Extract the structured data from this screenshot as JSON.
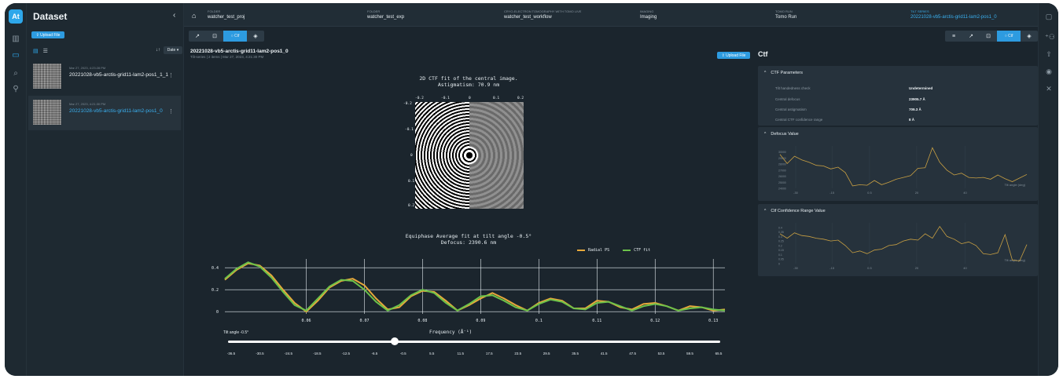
{
  "app": {
    "logo": "At"
  },
  "rail_icons": [
    "chart-icon",
    "folder-icon",
    "search-icon",
    "search-filter-icon"
  ],
  "dataset": {
    "title": "Dataset",
    "collapse": "‹",
    "upload_label": "⇪ Upload File",
    "sort_label": "Date ▾",
    "items": [
      {
        "date": "Mar 27, 2023, 4:23:28 PM",
        "name": "20221028-vb5-arctis-grid11-lam2-pos1_1_1",
        "selected": false
      },
      {
        "date": "Mar 27, 2023, 4:21:30 PM",
        "name": "20221028-vb5-arctis-grid11-lam2-pos1_0",
        "selected": true
      }
    ]
  },
  "breadcrumbs": [
    {
      "key": "FOLDER",
      "value": "watcher_test_proj"
    },
    {
      "key": "FOLDER",
      "value": "watcher_test_exp"
    },
    {
      "key": "CRYO-ELECTRON TOMOGRAPHY WITH TOMO LIVE",
      "value": "watcher_test_workflow"
    },
    {
      "key": "IMAGING",
      "value": "Imaging"
    },
    {
      "key": "TOMO RUN",
      "value": "Tomo Run"
    },
    {
      "key": "TILT SERIES",
      "value": "20221028-vb5-arctis-grid11-lam2-pos1_0"
    }
  ],
  "toolbar": {
    "active_label": "Ctf"
  },
  "series": {
    "title": "20221028-vb5-arctis-grid11-lam2-pos1_0",
    "subtitle": "Tilt-series  |  2 items  |  Mar 27, 2023, 4:21:30 PM",
    "upload_label": "⇪ Upload File"
  },
  "ctf_image": {
    "caption1": "2D CTF fit of the central image.",
    "caption2": "Astigmatism: 70.9 nm",
    "x_ticks": [
      "-0.2",
      "-0.1",
      "0",
      "0.1",
      "0.2"
    ],
    "y_ticks": [
      "-0.2",
      "-0.1",
      "0",
      "0.1",
      "0.2"
    ]
  },
  "chart_data": [
    {
      "type": "line",
      "title": "Equiphase Average fit at tilt angle -0.5°",
      "subtitle": "Defocus: 2390.6 nm",
      "xlabel": "Frequency (Å⁻¹)",
      "ylabel": "",
      "xlim": [
        0.046,
        0.132
      ],
      "ylim": [
        -0.02,
        0.48
      ],
      "x_ticks": [
        0.06,
        0.07,
        0.08,
        0.09,
        0.1,
        0.11,
        0.12,
        0.13
      ],
      "y_ticks": [
        0,
        0.2,
        0.4
      ],
      "series": [
        {
          "name": "Radial PS",
          "color": "#e7a93b",
          "x": [
            0.046,
            0.048,
            0.05,
            0.052,
            0.054,
            0.056,
            0.058,
            0.06,
            0.062,
            0.064,
            0.066,
            0.068,
            0.07,
            0.072,
            0.074,
            0.076,
            0.078,
            0.08,
            0.082,
            0.084,
            0.086,
            0.088,
            0.09,
            0.092,
            0.094,
            0.096,
            0.098,
            0.1,
            0.102,
            0.104,
            0.106,
            0.108,
            0.11,
            0.112,
            0.114,
            0.116,
            0.118,
            0.12,
            0.122,
            0.124,
            0.126,
            0.128,
            0.13,
            0.132
          ],
          "y": [
            0.29,
            0.38,
            0.44,
            0.42,
            0.33,
            0.2,
            0.08,
            0.0,
            0.1,
            0.22,
            0.28,
            0.3,
            0.24,
            0.12,
            0.02,
            0.04,
            0.14,
            0.19,
            0.18,
            0.1,
            0.01,
            0.06,
            0.12,
            0.17,
            0.12,
            0.06,
            0.01,
            0.08,
            0.12,
            0.1,
            0.03,
            0.03,
            0.1,
            0.09,
            0.04,
            0.02,
            0.07,
            0.08,
            0.05,
            0.01,
            0.05,
            0.04,
            0.01,
            0.02
          ]
        },
        {
          "name": "CTF fit",
          "color": "#6cc24a",
          "x": [
            0.046,
            0.048,
            0.05,
            0.052,
            0.054,
            0.056,
            0.058,
            0.06,
            0.062,
            0.064,
            0.066,
            0.068,
            0.07,
            0.072,
            0.074,
            0.076,
            0.078,
            0.08,
            0.082,
            0.084,
            0.086,
            0.088,
            0.09,
            0.092,
            0.094,
            0.096,
            0.098,
            0.1,
            0.102,
            0.104,
            0.106,
            0.108,
            0.11,
            0.112,
            0.114,
            0.116,
            0.118,
            0.12,
            0.122,
            0.124,
            0.126,
            0.128,
            0.13,
            0.132
          ],
          "y": [
            0.3,
            0.39,
            0.45,
            0.41,
            0.31,
            0.18,
            0.06,
            0.01,
            0.12,
            0.23,
            0.29,
            0.28,
            0.2,
            0.09,
            0.01,
            0.06,
            0.15,
            0.2,
            0.17,
            0.08,
            0.01,
            0.07,
            0.14,
            0.15,
            0.1,
            0.04,
            0.01,
            0.07,
            0.11,
            0.09,
            0.03,
            0.02,
            0.08,
            0.09,
            0.05,
            0.01,
            0.05,
            0.07,
            0.05,
            0.01,
            0.03,
            0.04,
            0.02,
            0.01
          ]
        }
      ]
    },
    {
      "type": "line",
      "title": "Defocus Value",
      "xlabel": "Tilt angle (deg)",
      "ylim": [
        24000,
        31000
      ],
      "x_ticks": [
        -30,
        -15,
        0.5,
        20,
        40
      ],
      "y_ticks": [
        24000,
        25000,
        26000,
        27000,
        28000,
        29000,
        30000
      ],
      "series": [
        {
          "name": "",
          "color": "#c9a043",
          "x": [
            -36.5,
            -33.5,
            -30.5,
            -27.5,
            -24.5,
            -21.5,
            -18.5,
            -15.5,
            -12.5,
            -9.5,
            -6.5,
            -3.5,
            -0.5,
            2.5,
            5.5,
            8.5,
            11.5,
            14.5,
            17.5,
            20.5,
            23.5,
            26.5,
            29.5,
            32.5,
            35.5,
            38.5,
            41.5,
            44.5,
            47.5,
            50.5,
            53.5,
            56.5,
            59.5,
            62.5,
            65.5
          ],
          "y": [
            29600,
            28100,
            29300,
            28700,
            28300,
            27800,
            27700,
            27200,
            27500,
            26600,
            24400,
            24600,
            24500,
            25300,
            24600,
            25000,
            25500,
            25800,
            26100,
            27300,
            27400,
            30700,
            28300,
            27000,
            26200,
            26500,
            25800,
            25700,
            25800,
            25500,
            26200,
            25600,
            25100,
            25700,
            26300
          ]
        }
      ]
    },
    {
      "type": "line",
      "title": "Ctf Confidence Range Value",
      "xlabel": "Tilt angle (deg)",
      "ylim": [
        0,
        0.45
      ],
      "x_ticks": [
        -30,
        -15,
        0.5,
        20,
        40
      ],
      "y_ticks": [
        0.0,
        0.05,
        0.1,
        0.15,
        0.2,
        0.25,
        0.3,
        0.35,
        0.4
      ],
      "series": [
        {
          "name": "",
          "color": "#c9a043",
          "x": [
            -36.5,
            -33.5,
            -30.5,
            -27.5,
            -24.5,
            -21.5,
            -18.5,
            -15.5,
            -12.5,
            -9.5,
            -6.5,
            -3.5,
            -0.5,
            2.5,
            5.5,
            8.5,
            11.5,
            14.5,
            17.5,
            20.5,
            23.5,
            26.5,
            29.5,
            32.5,
            35.5,
            38.5,
            41.5,
            44.5,
            47.5,
            50.5,
            53.5,
            56.5,
            59.5,
            62.5,
            65.5
          ],
          "y": [
            0.33,
            0.28,
            0.34,
            0.31,
            0.3,
            0.28,
            0.27,
            0.25,
            0.26,
            0.2,
            0.12,
            0.14,
            0.11,
            0.15,
            0.16,
            0.2,
            0.21,
            0.25,
            0.27,
            0.26,
            0.33,
            0.28,
            0.41,
            0.3,
            0.27,
            0.22,
            0.24,
            0.2,
            0.11,
            0.1,
            0.12,
            0.32,
            0.04,
            0.03,
            0.21
          ]
        }
      ]
    }
  ],
  "slider": {
    "label": "Tilt angle -0.5°",
    "value": -0.5,
    "min": -36.5,
    "max": 65.5,
    "ticks": [
      "-36.5",
      "-30.5",
      "-24.5",
      "-18.5",
      "-12.5",
      "-6.5",
      "-0.5",
      "5.5",
      "11.5",
      "17.5",
      "23.5",
      "29.5",
      "35.5",
      "41.5",
      "47.5",
      "53.5",
      "59.5",
      "65.5"
    ]
  },
  "ctf_panel": {
    "heading": "Ctf",
    "params_title": "CTF Parameters",
    "params": [
      {
        "label": "Tilt handedness check",
        "value": "Undetermined"
      },
      {
        "label": "Central defocus",
        "value": "23905.7 Å"
      },
      {
        "label": "Central astigmatism",
        "value": "709.3 Å"
      },
      {
        "label": "Central CTF confidence range",
        "value": "8 Å"
      }
    ],
    "defocus_title": "Defocus Value",
    "confidence_title": "Ctf Confidence Range Value",
    "tilt_axis_label": "Tilt angle (deg)"
  },
  "colors": {
    "accent": "#2d9be0",
    "background": "#1b252d",
    "panel": "#26323c"
  }
}
